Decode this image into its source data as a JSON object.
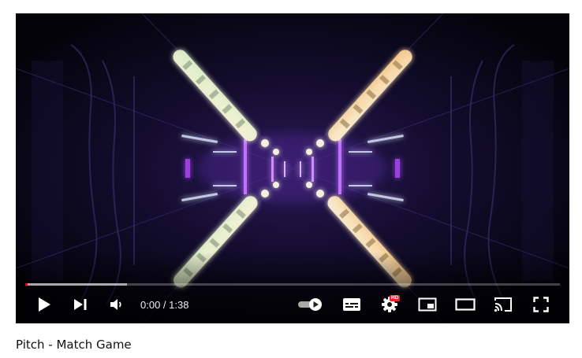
{
  "player": {
    "current_time": "0:00",
    "duration": "1:38",
    "time_separator": " / ",
    "progress_played_fraction": 0.005,
    "progress_loaded_fraction": 0.19,
    "hd_badge": "HD",
    "autoplay_on": true
  },
  "controls": {
    "play_icon": "play-icon",
    "next_icon": "skip-next-icon",
    "volume_icon": "volume-icon",
    "autoplay_icon": "autoplay-toggle-icon",
    "subtitles_icon": "subtitles-icon",
    "settings_icon": "gear-icon",
    "miniplayer_icon": "miniplayer-icon",
    "theater_icon": "theater-mode-icon",
    "cast_icon": "cast-icon",
    "fullscreen_icon": "fullscreen-icon"
  },
  "video": {
    "title": "Pitch - Match Game"
  },
  "colors": {
    "progress_played": "#ff0000",
    "hd_badge": "#e4252b",
    "neon_purple": "#a040ff",
    "light_warm": "#f3e3b0"
  }
}
